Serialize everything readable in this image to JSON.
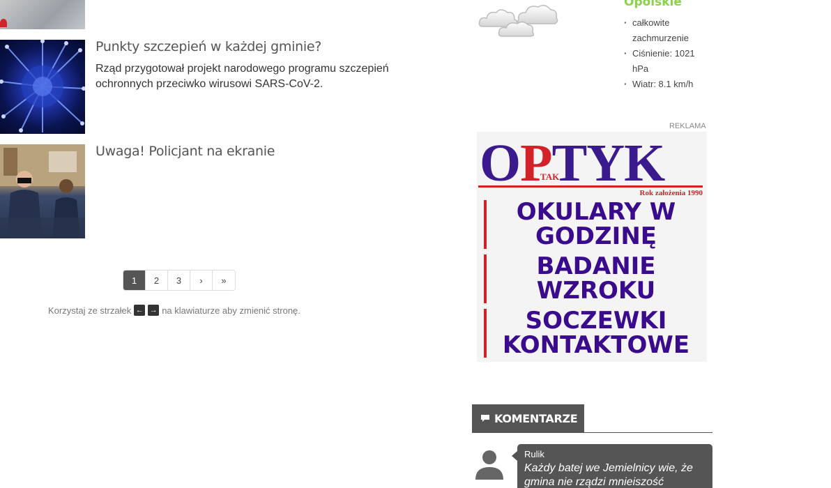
{
  "articles": [
    {
      "title": "Punkty szczepień w każdej gminie?",
      "lead": "Rząd przygotował projekt narodowego programu szczepień ochronnych przeciwko wirusowi SARS-CoV-2."
    },
    {
      "title": "Uwaga! Policjant na ekranie",
      "lead": ""
    }
  ],
  "pagination": {
    "pages": [
      "1",
      "2",
      "3"
    ],
    "active": "1",
    "next": "›",
    "last": "»"
  },
  "keyboard_hint": {
    "before": "Korzystaj ze strzałek",
    "left_key": "←",
    "right_key": "→",
    "after": "na klawiaturze aby zmienić stronę."
  },
  "weather": {
    "region": "Opolskie",
    "icon": "cloudy-icon",
    "items": [
      "całkowite zachmurzenie",
      "Ciśnienie: 1021 hPa",
      "Wiatr: 8.1 km/h"
    ]
  },
  "ad": {
    "label": "REKLAMA",
    "brand_o": "O",
    "brand_p": "P",
    "brand_rest": "TYK",
    "brand_tak": "TAK",
    "founded": "Rok założenia 1990",
    "lines": [
      "OKULARY W GODZINĘ",
      "BADANIE WZROKU",
      "SOCZEWKI KONTAKTOWE"
    ]
  },
  "comments_section": {
    "title": "KOMENTARZE",
    "icon": "comment-icon",
    "items": [
      {
        "author": "Rulik",
        "text": "Każdy batej we Jemielnicy wie, że gmina nie rządzi mnieiszość"
      }
    ]
  },
  "colors": {
    "accent_green": "#8bd14a",
    "dark_gray": "#555555",
    "ad_purple": "#3a0b8c",
    "ad_red": "#d2232a"
  }
}
